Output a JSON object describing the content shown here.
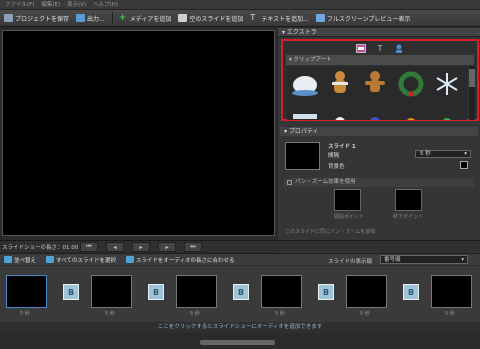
{
  "menu": [
    "ファイル(F)",
    "編集(E)",
    "表示(V)",
    "ヘルプ(H)"
  ],
  "toolbar": {
    "save": "プロジェクトを保存",
    "output": "出力...",
    "add_media": "メディアを追加",
    "add_blank": "空のスライドを追加",
    "add_text": "テキストを追加...",
    "fullscreen": "フルスクリーンプレビュー表示"
  },
  "extras": {
    "title": "エクストラ",
    "category": "クリップアート"
  },
  "properties": {
    "title": "プロパティ",
    "slide": "スライド 1",
    "duration_label": "間隔",
    "duration_value": "5 秒",
    "bg_label": "背景色",
    "bg_color": "#000000",
    "panzoom": "パン・ズーム効果を使用",
    "start": "開始ポイント",
    "end": "終了ポイント",
    "note": "このスライドに同じパン・ズームを追加"
  },
  "status": {
    "duration": "スライドショーの長さ：01:00"
  },
  "slidetools": {
    "sort": "並べ替え",
    "select_all": "すべてのスライドを選択",
    "fit_audio": "スライドをオーディオの長さに合わせる",
    "show_label": "スライドの表示順",
    "show_value": "番号順"
  },
  "slides": {
    "durations": [
      "5 秒",
      "5 秒",
      "5 秒",
      "5 秒",
      "5 秒",
      "5 秒"
    ],
    "transition": "B"
  },
  "note": "ここをクリックするとスライドショーにオーディオを追加できます"
}
